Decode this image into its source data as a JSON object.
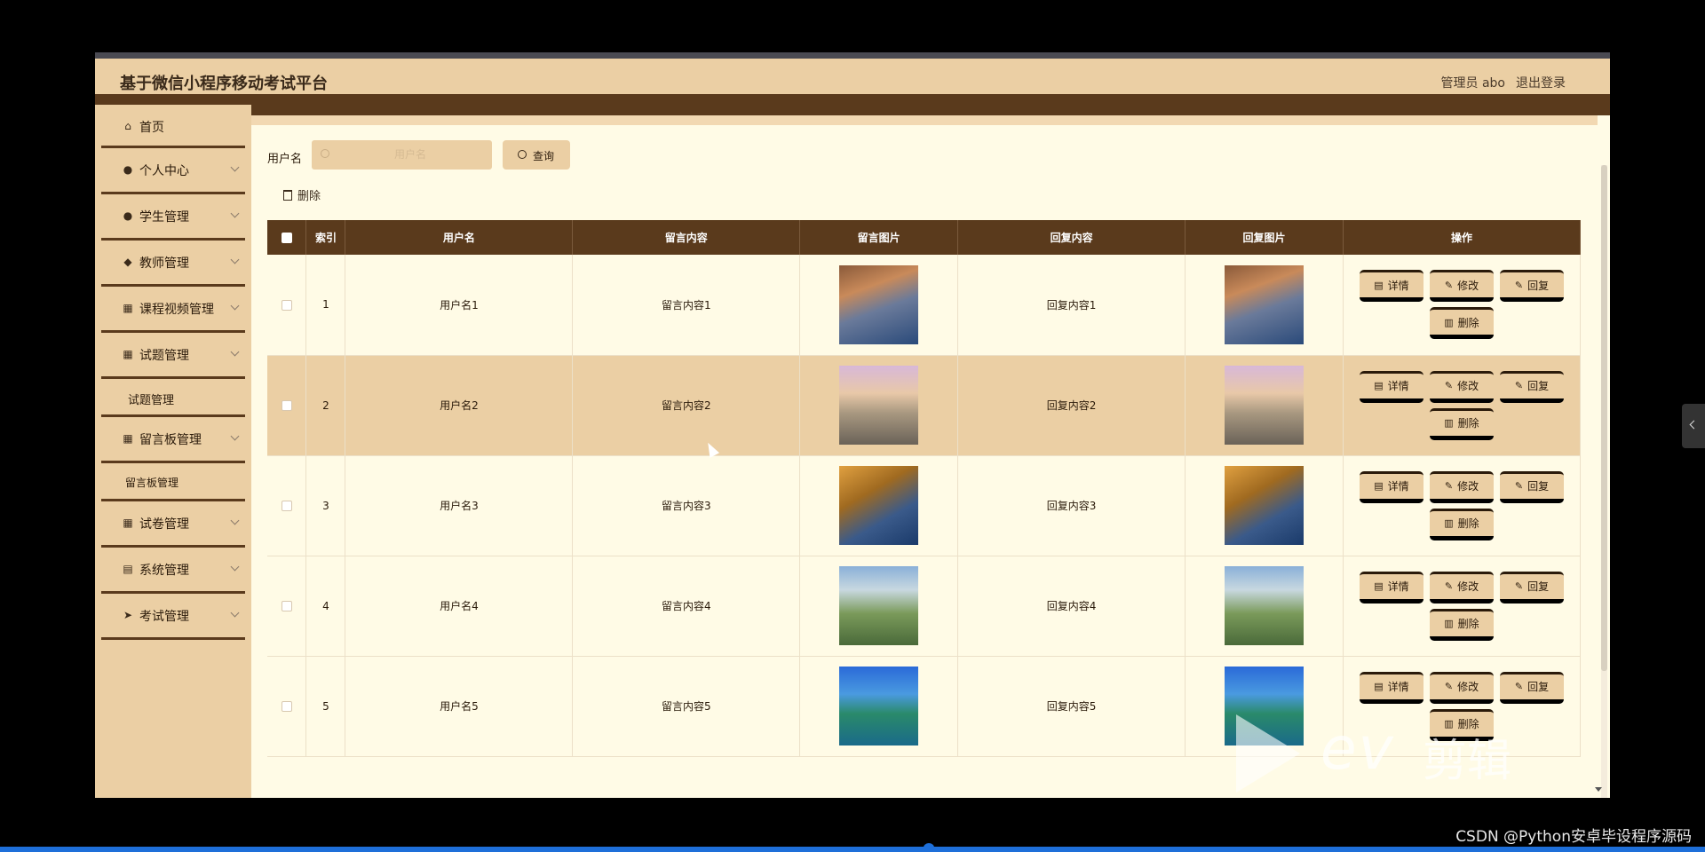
{
  "header": {
    "title": "基于微信小程序移动考试平台",
    "admin": "管理员 abo",
    "logout": "退出登录"
  },
  "sidebar": {
    "items": [
      {
        "label": "首页",
        "icon": "home-icon"
      },
      {
        "label": "个人中心",
        "icon": "user-icon"
      },
      {
        "label": "学生管理",
        "icon": "user-icon"
      },
      {
        "label": "教师管理",
        "icon": "location-icon"
      },
      {
        "label": "课程视频管理",
        "icon": "grid-icon"
      },
      {
        "label": "试题管理",
        "icon": "grid-icon"
      },
      {
        "label": "试题管理",
        "icon": ""
      },
      {
        "label": "留言板管理",
        "icon": "grid-icon"
      },
      {
        "label": "留言板管理",
        "icon": ""
      },
      {
        "label": "试卷管理",
        "icon": "grid-icon"
      },
      {
        "label": "系统管理",
        "icon": "doc-icon"
      },
      {
        "label": "考试管理",
        "icon": "send-icon"
      }
    ]
  },
  "search": {
    "label": "用户名",
    "placeholder": "用户名",
    "query_button": "查询",
    "delete_button": "删除"
  },
  "table": {
    "columns": [
      "索引",
      "用户名",
      "留言内容",
      "留言图片",
      "回复内容",
      "回复图片",
      "操作"
    ],
    "rows": [
      {
        "index": "1",
        "username": "用户名1",
        "message": "留言内容1",
        "reply": "回复内容1"
      },
      {
        "index": "2",
        "username": "用户名2",
        "message": "留言内容2",
        "reply": "回复内容2"
      },
      {
        "index": "3",
        "username": "用户名3",
        "message": "留言内容3",
        "reply": "回复内容3"
      },
      {
        "index": "4",
        "username": "用户名4",
        "message": "留言内容4",
        "reply": "回复内容4"
      },
      {
        "index": "5",
        "username": "用户名5",
        "message": "留言内容5",
        "reply": "回复内容5"
      }
    ],
    "actions": {
      "detail": "详情",
      "edit": "修改",
      "reply": "回复",
      "delete": "删除"
    }
  },
  "overlay": {
    "watermark": "CSDN @Python安卓毕设程序源码",
    "logo_text": "ev",
    "logo_cn": "剪辑"
  },
  "colors": {
    "accent": "#5a3a1c",
    "panel": "#ebcfa4",
    "background": "#fffbe6"
  }
}
